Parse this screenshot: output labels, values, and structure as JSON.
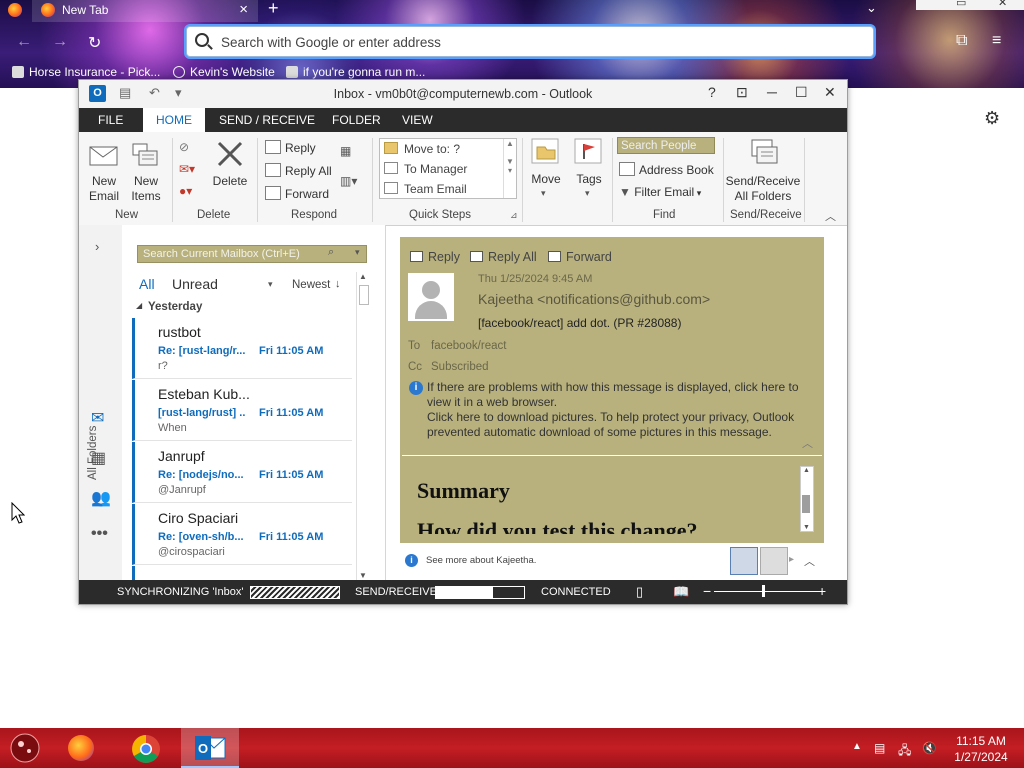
{
  "browser": {
    "tab_title": "New Tab",
    "urlbar_placeholder": "Search with Google or enter address",
    "bookmarks": [
      "Horse Insurance - Pick...",
      "Kevin's Website",
      "if you're gonna run m..."
    ]
  },
  "outlook": {
    "window_title": "Inbox - vm0b0t@computernewb.com - Outlook",
    "menu": [
      "FILE",
      "HOME",
      "SEND / RECEIVE",
      "FOLDER",
      "VIEW"
    ],
    "ribbon": {
      "new_email": "New Email",
      "new_items": "New Items",
      "delete": "Delete",
      "reply": "Reply",
      "reply_all": "Reply All",
      "forward": "Forward",
      "quick_steps": [
        "Move to: ?",
        "To Manager",
        "Team Email"
      ],
      "move": "Move",
      "tags": "Tags",
      "search_people": "Search People",
      "address_book": "Address Book",
      "filter_email": "Filter Email",
      "send_receive_all": "Send/Receive All Folders",
      "groups": [
        "New",
        "Delete",
        "Respond",
        "Quick Steps",
        "Find",
        "Send/Receive"
      ]
    },
    "nav_rail": {
      "all_folders": "All Folders"
    },
    "message_list": {
      "search_placeholder": "Search Current Mailbox (Ctrl+E)",
      "filter_all": "All",
      "filter_unread": "Unread",
      "sort": "Newest",
      "group_header": "Yesterday",
      "items": [
        {
          "from": "rustbot",
          "subject": "Re: [rust-lang/r...",
          "time": "Fri 11:05 AM",
          "preview": "r?"
        },
        {
          "from": "Esteban Kub...",
          "subject": "[rust-lang/rust] ...",
          "time": "Fri 11:05 AM",
          "preview": "When"
        },
        {
          "from": "Janrupf",
          "subject": "Re: [nodejs/no...",
          "time": "Fri 11:05 AM",
          "preview": "@Janrupf"
        },
        {
          "from": "Ciro Spaciari",
          "subject": "Re: [oven-sh/b...",
          "time": "Fri 11:05 AM",
          "preview": "@cirospaciari"
        }
      ]
    },
    "reading_pane": {
      "actions": [
        "Reply",
        "Reply All",
        "Forward"
      ],
      "date": "Thu 1/25/2024 9:45 AM",
      "sender": "Kajeetha <notifications@github.com>",
      "subject": "[facebook/react] add dot. (PR #28088)",
      "to_label": "To",
      "to_value": "facebook/react",
      "cc_label": "Cc",
      "cc_value": "Subscribed",
      "info_line1": "If there are problems with how this message is displayed, click here to view it in a web browser.",
      "info_line2": "Click here to download pictures. To help protect your privacy, Outlook prevented automatic download of some pictures in this message.",
      "body_heading": "Summary",
      "body_next": "How did you test this change?",
      "people_text": "See more about Kajeetha."
    },
    "status_bar": {
      "sync": "SYNCHRONIZING  'Inbox'",
      "send_receive": "SEND/RECEIVE",
      "send_receive_progress": 0.65,
      "connected": "CONNECTED"
    }
  },
  "taskbar": {
    "time": "11:15 AM",
    "date": "1/27/2024"
  }
}
